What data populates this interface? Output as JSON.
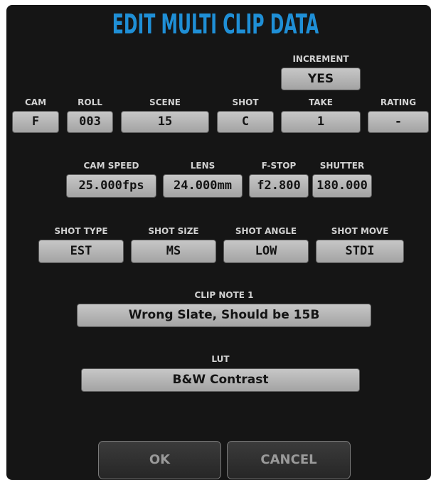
{
  "dialog": {
    "title": "EDIT MULTI CLIP DATA"
  },
  "increment": {
    "label": "INCREMENT",
    "value": "YES"
  },
  "row1": {
    "cam": {
      "label": "CAM",
      "value": "F"
    },
    "roll": {
      "label": "ROLL",
      "value": "003"
    },
    "scene": {
      "label": "SCENE",
      "value": "15"
    },
    "shot": {
      "label": "SHOT",
      "value": "C"
    },
    "take": {
      "label": "TAKE",
      "value": "1"
    },
    "rating": {
      "label": "RATING",
      "value": "-"
    }
  },
  "row2": {
    "cam_speed": {
      "label": "CAM SPEED",
      "value": "25.000fps"
    },
    "lens": {
      "label": "LENS",
      "value": "24.000mm"
    },
    "f_stop": {
      "label": "F-STOP",
      "value": "f2.800"
    },
    "shutter": {
      "label": "SHUTTER",
      "value": "180.000"
    }
  },
  "row3": {
    "shot_type": {
      "label": "SHOT TYPE",
      "value": "EST"
    },
    "shot_size": {
      "label": "SHOT SIZE",
      "value": "MS"
    },
    "shot_angle": {
      "label": "SHOT ANGLE",
      "value": "LOW"
    },
    "shot_move": {
      "label": "SHOT MOVE",
      "value": "STDI"
    }
  },
  "clip_note": {
    "label": "CLIP NOTE 1",
    "value": "Wrong Slate, Should be 15B"
  },
  "lut": {
    "label": "LUT",
    "value": "B&W Contrast"
  },
  "buttons": {
    "ok": "OK",
    "cancel": "CANCEL"
  },
  "colors": {
    "title": "#1f8fd6",
    "background": "#151515",
    "field": "#b8b8b8"
  }
}
